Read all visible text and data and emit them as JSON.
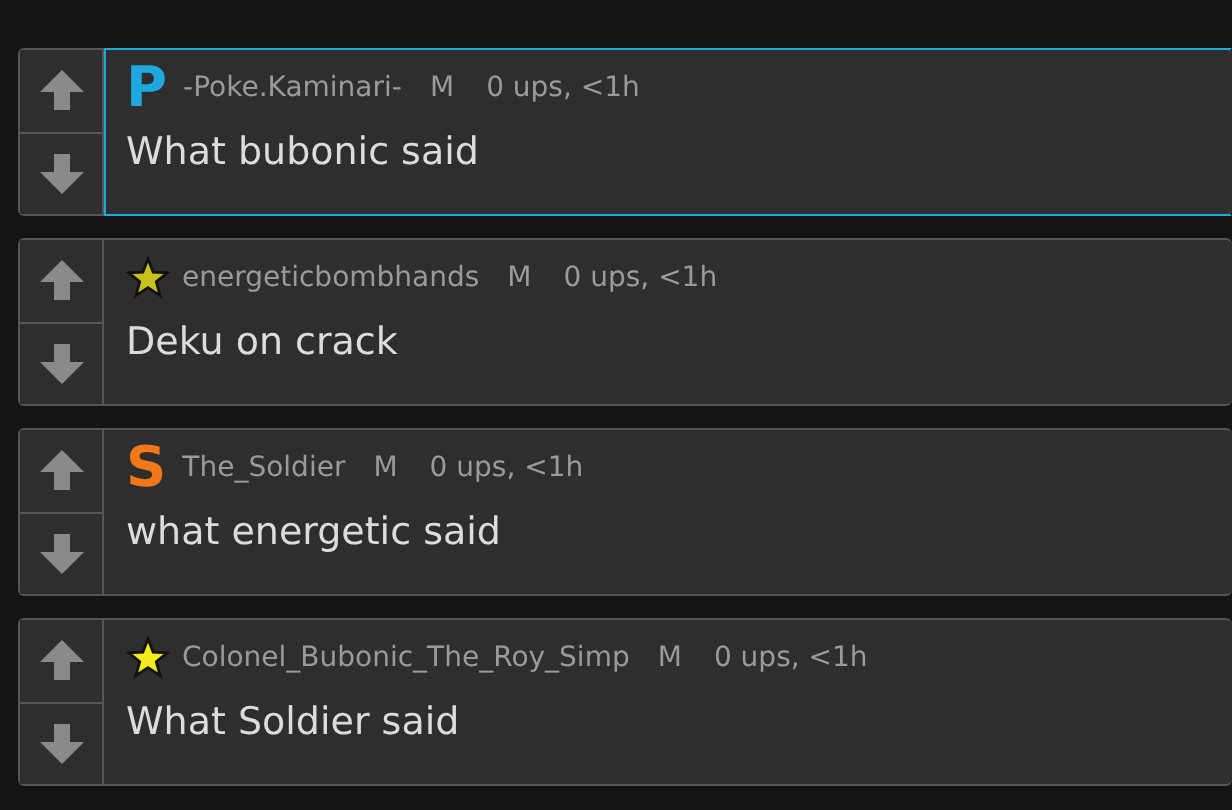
{
  "comments": [
    {
      "author": "-Poke.Kaminari-",
      "badge": {
        "kind": "letter",
        "text": "P",
        "color": "#1ea8e0"
      },
      "tag": "M",
      "stats": "0 ups, <1h",
      "text": "What bubonic said",
      "selected": true
    },
    {
      "author": "energeticbombhands",
      "badge": {
        "kind": "star",
        "color": "#c9c21c"
      },
      "tag": "M",
      "stats": "0 ups, <1h",
      "text": "Deku on crack",
      "selected": false
    },
    {
      "author": "The_Soldier",
      "badge": {
        "kind": "letter",
        "text": "S",
        "color": "#f07818"
      },
      "tag": "M",
      "stats": "0 ups, <1h",
      "text": "what energetic said",
      "selected": false
    },
    {
      "author": "Colonel_Bubonic_The_Roy_Simp",
      "badge": {
        "kind": "star",
        "color": "#f2ec1c"
      },
      "tag": "M",
      "stats": "0 ups, <1h",
      "text": "What Soldier said",
      "selected": false
    }
  ]
}
